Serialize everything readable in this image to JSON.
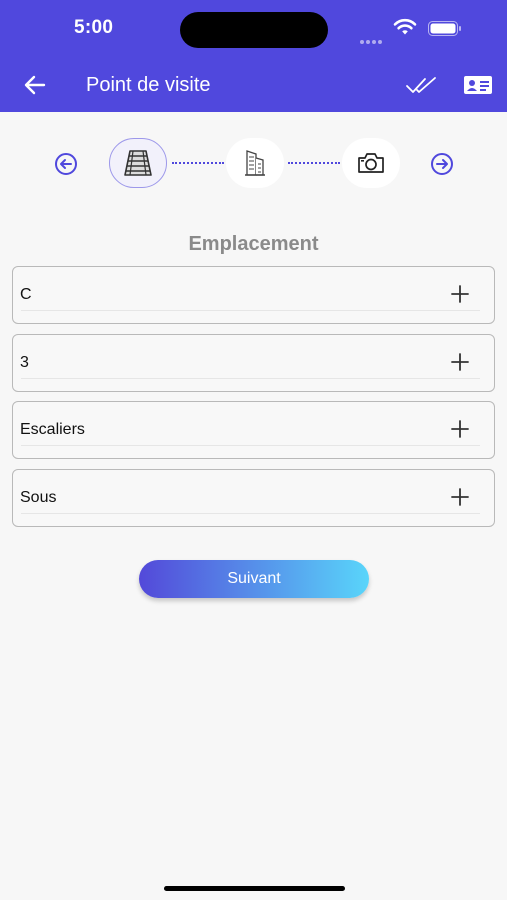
{
  "status_bar": {
    "time": "5:00"
  },
  "header": {
    "title": "Point de visite",
    "back_icon": "arrow-left-icon",
    "action_icons": [
      "double-check-icon",
      "id-card-icon"
    ],
    "background": "#5048dd"
  },
  "stepper": {
    "prev_icon": "arrow-left-circle-icon",
    "next_icon": "arrow-right-circle-icon",
    "steps": [
      {
        "icon": "stairs-icon",
        "active": true
      },
      {
        "icon": "building-icon",
        "active": false
      },
      {
        "icon": "camera-icon",
        "active": false
      }
    ]
  },
  "section": {
    "title": "Emplacement"
  },
  "fields": [
    {
      "value": "C"
    },
    {
      "value": "3"
    },
    {
      "value": "Escaliers"
    },
    {
      "value": "Sous"
    }
  ],
  "actions": {
    "next_label": "Suivant"
  },
  "colors": {
    "accent": "#5048dd",
    "gradient_start": "#5349d9",
    "gradient_end": "#59d5fa"
  }
}
